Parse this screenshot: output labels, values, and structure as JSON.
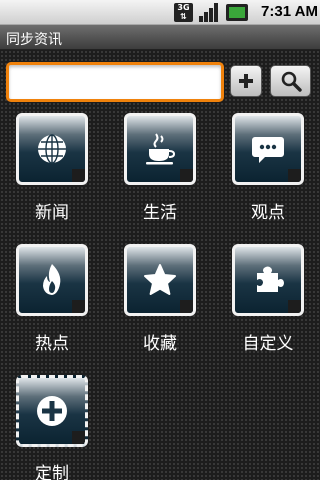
{
  "status_bar": {
    "network": "3G",
    "time": "7:31 AM"
  },
  "title": "同步资讯",
  "search": {
    "value": "",
    "placeholder": ""
  },
  "toolbar": {
    "add_icon": "plus-icon",
    "search_icon": "magnifier-icon"
  },
  "grid": [
    {
      "label": "新闻",
      "icon": "globe-icon"
    },
    {
      "label": "生活",
      "icon": "coffee-cup-icon"
    },
    {
      "label": "观点",
      "icon": "speech-bubble-icon"
    },
    {
      "label": "热点",
      "icon": "flame-icon"
    },
    {
      "label": "收藏",
      "icon": "star-icon"
    },
    {
      "label": "自定义",
      "icon": "puzzle-icon"
    },
    {
      "label": "定制",
      "icon": "plus-circle-icon"
    }
  ],
  "colors": {
    "accent": "#f0820c",
    "background": "#1d1d1d",
    "tile_dark": "#0b2331"
  }
}
